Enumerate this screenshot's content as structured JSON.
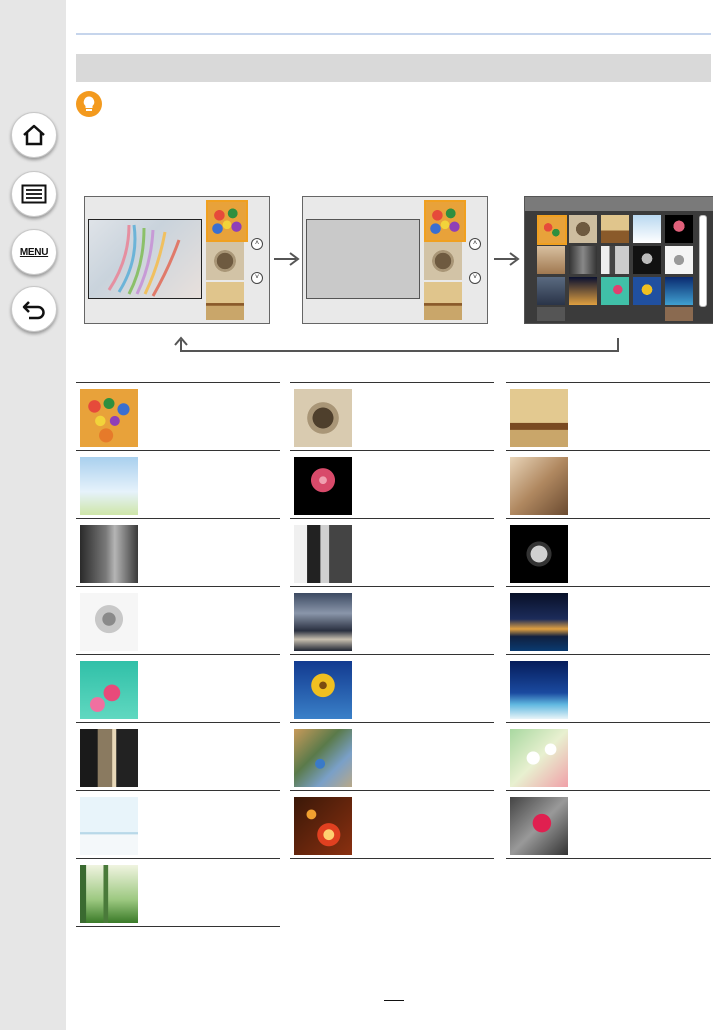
{
  "nav": {
    "home": "home-icon",
    "contents": "list-icon",
    "menu_label": "MENU",
    "back": "back-icon"
  },
  "tip_icon": "lightbulb-icon",
  "colors": {
    "sidebar": "#e6e6e6",
    "section_bar": "#d9d9d9",
    "tip": "#f39a1e",
    "top_rule": "#c6d5ec"
  },
  "scroll_icons": {
    "up": "˄",
    "down": "˅"
  },
  "grid_cells": [
    {
      "subject": "candies"
    },
    {
      "subject": "pocket-watch"
    },
    {
      "subject": "chair"
    },
    {
      "subject": "daisies"
    },
    {
      "subject": "gerbera"
    },
    {
      "subject": "swing-girls"
    },
    {
      "subject": "street"
    },
    {
      "subject": "buildings"
    },
    {
      "subject": "bell"
    },
    {
      "subject": "tree"
    },
    {
      "subject": "cloudy-harbor"
    },
    {
      "subject": "night-city"
    },
    {
      "subject": "cosmos"
    },
    {
      "subject": "sunflower"
    },
    {
      "subject": "palm"
    },
    {
      "subject": "alley"
    },
    {
      "subject": "toy-city"
    },
    {
      "subject": "dandelions"
    },
    {
      "subject": "window"
    },
    {
      "subject": "candle"
    },
    {
      "subject": "red-flower"
    },
    {
      "subject": "forest"
    }
  ]
}
